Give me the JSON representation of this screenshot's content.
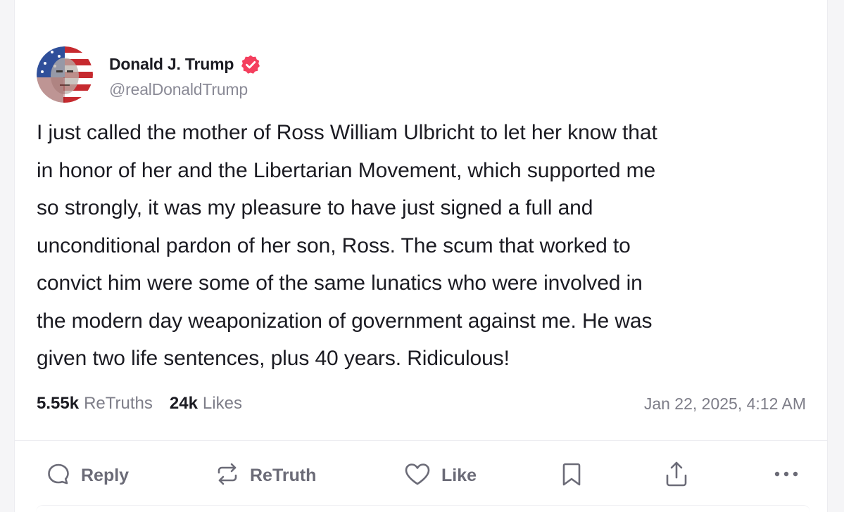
{
  "post": {
    "author": {
      "display_name": "Donald J. Trump",
      "handle": "@realDonaldTrump",
      "verified_icon": "verified-badge-icon",
      "accent_color": "#f43f5e"
    },
    "text": "I just called the mother of Ross William Ulbricht to let her know that\nin honor of her and the Libertarian Movement, which supported me\nso strongly, it was my pleasure to have just signed a full and\nunconditional pardon of her son, Ross. The scum that worked to\nconvict him were some of the same lunatics who were involved in\nthe modern day weaponization of government against me. He was\ngiven two life sentences, plus 40 years. Ridiculous!",
    "stats": {
      "retruths_count": "5.55k",
      "retruths_label": "ReTruths",
      "likes_count": "24k",
      "likes_label": "Likes"
    },
    "timestamp": "Jan 22, 2025, 4:12 AM"
  },
  "actions": {
    "reply": {
      "label": "Reply",
      "icon": "reply-icon"
    },
    "retruth": {
      "label": "ReTruth",
      "icon": "retruth-icon"
    },
    "like": {
      "label": "Like",
      "icon": "heart-icon"
    },
    "bookmark": {
      "icon": "bookmark-icon"
    },
    "share": {
      "icon": "share-icon"
    },
    "more": {
      "icon": "more-icon"
    }
  }
}
